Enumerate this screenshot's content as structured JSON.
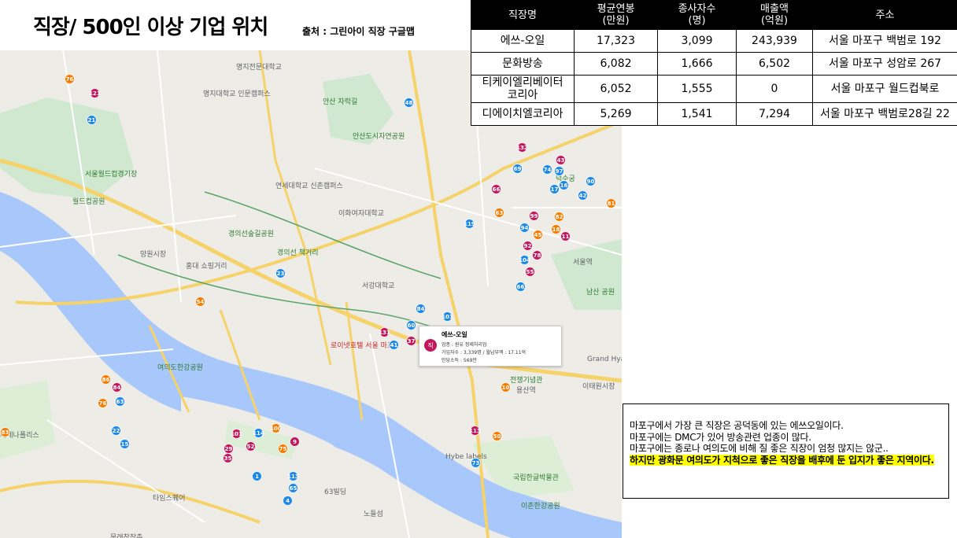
{
  "header": {
    "title": "직장/ 500인 이상 기업 위치",
    "source": "출처 : 그린아이 직장 구글맵"
  },
  "table": {
    "headers": [
      "직장명",
      "평균연봉\n(만원)",
      "종사자수\n(명)",
      "매출액\n(억원)",
      "주소"
    ],
    "rows": [
      {
        "name": "에쓰-오일",
        "salary": "17,323",
        "employees": "3,099",
        "revenue": "243,939",
        "address": "서울 마포구 백범로 192"
      },
      {
        "name": "문화방송",
        "salary": "6,082",
        "employees": "1,666",
        "revenue": "6,502",
        "address": "서울 마포구 성암로 267"
      },
      {
        "name": "티케이엘리베이터\n코리아",
        "salary": "6,052",
        "employees": "1,555",
        "revenue": "0",
        "address": "서울 마포구 월드컵북로"
      },
      {
        "name": "디에이치엘코리아",
        "salary": "5,269",
        "employees": "1,541",
        "revenue": "7,294",
        "address": "서울 마포구 백범로28길 22"
      }
    ]
  },
  "note": {
    "lines": [
      "마포구에서 가장 큰 직장은 공덕동에 있는 에쓰오일이다.",
      "마포구에는 DMC가 있어 방송관련 업종이 많다.",
      "마포구에는 종로나 여의도에 비해 질 좋은 직장이 엄청 많지는 않군..",
      "하지만 광화문 여의도가 지척으로 좋은 직장을 배후에 둔 입지가 좋은 지역이다."
    ]
  },
  "map": {
    "colors": {
      "pink": "#c2185b",
      "blue": "#1e88e5",
      "orange": "#f57c00",
      "river": "#a8c7fa",
      "park": "#c8e6c9"
    },
    "popup": {
      "avatar": "직",
      "name": "에쓰-오일",
      "industry": "업종 : 원유 정제처리업",
      "stats": "가입자수 : 3,339명 / 월납부액 : 17.11억",
      "per_capita": "인당소득 : 569만"
    },
    "labels": [
      "명지전문대학교",
      "명지대학교 인문캠퍼스",
      "안산 자락길",
      "안산도시자연공원",
      "연세대학교 신촌캠퍼스",
      "이화여자대학교",
      "서울월드컵경기장",
      "월드컵공원",
      "경의선숲길공원",
      "망원시장",
      "홍대 쇼핑거리",
      "경의선 책거리",
      "서강대학교",
      "서울역",
      "용산역",
      "여의도한강공원",
      "63빌딩",
      "국립한글박물관",
      "Hybe labels",
      "전쟁기념관",
      "노들섬",
      "이촌한강공원",
      "Grand Hyatt",
      "이태원시장",
      "남산 공원",
      "덕수궁",
      "메세나폴리스",
      "로이넷호텔 서울 마포",
      "타임스퀘어",
      "문래창작촌"
    ],
    "markers": [
      {
        "n": "76",
        "c": "orange"
      },
      {
        "n": "121",
        "c": "pink"
      },
      {
        "n": "21",
        "c": "blue"
      },
      {
        "n": "48",
        "c": "blue"
      },
      {
        "n": "132",
        "c": "pink"
      },
      {
        "n": "43",
        "c": "pink"
      },
      {
        "n": "69",
        "c": "blue"
      },
      {
        "n": "74",
        "c": "blue"
      },
      {
        "n": "97",
        "c": "blue"
      },
      {
        "n": "16",
        "c": "blue"
      },
      {
        "n": "17",
        "c": "blue"
      },
      {
        "n": "90",
        "c": "blue"
      },
      {
        "n": "42",
        "c": "blue"
      },
      {
        "n": "66",
        "c": "pink"
      },
      {
        "n": "81",
        "c": "orange"
      },
      {
        "n": "63",
        "c": "orange"
      },
      {
        "n": "82",
        "c": "orange"
      },
      {
        "n": "99",
        "c": "pink"
      },
      {
        "n": "119",
        "c": "blue"
      },
      {
        "n": "94",
        "c": "blue"
      },
      {
        "n": "45",
        "c": "orange"
      },
      {
        "n": "18",
        "c": "orange"
      },
      {
        "n": "11",
        "c": "pink"
      },
      {
        "n": "92",
        "c": "pink"
      },
      {
        "n": "78",
        "c": "pink"
      },
      {
        "n": "55",
        "c": "pink"
      },
      {
        "n": "104",
        "c": "blue"
      },
      {
        "n": "66",
        "c": "blue"
      },
      {
        "n": "23",
        "c": "blue"
      },
      {
        "n": "54",
        "c": "orange"
      },
      {
        "n": "84",
        "c": "blue"
      },
      {
        "n": "101",
        "c": "blue"
      },
      {
        "n": "131",
        "c": "pink"
      },
      {
        "n": "60",
        "c": "blue"
      },
      {
        "n": "41",
        "c": "blue"
      },
      {
        "n": "37",
        "c": "pink"
      },
      {
        "n": "86",
        "c": "orange"
      },
      {
        "n": "84",
        "c": "pink"
      },
      {
        "n": "76",
        "c": "orange"
      },
      {
        "n": "63",
        "c": "blue"
      },
      {
        "n": "22",
        "c": "blue"
      },
      {
        "n": "15",
        "c": "blue"
      },
      {
        "n": "101",
        "c": "pink"
      },
      {
        "n": "114",
        "c": "blue"
      },
      {
        "n": "100",
        "c": "orange"
      },
      {
        "n": "29",
        "c": "pink"
      },
      {
        "n": "52",
        "c": "pink"
      },
      {
        "n": "35",
        "c": "pink"
      },
      {
        "n": "9",
        "c": "pink"
      },
      {
        "n": "75",
        "c": "orange"
      },
      {
        "n": "1",
        "c": "blue"
      },
      {
        "n": "113",
        "c": "blue"
      },
      {
        "n": "4",
        "c": "blue"
      },
      {
        "n": "10",
        "c": "orange"
      },
      {
        "n": "113",
        "c": "pink"
      },
      {
        "n": "73",
        "c": "blue"
      },
      {
        "n": "83",
        "c": "orange"
      },
      {
        "n": "65",
        "c": "blue"
      },
      {
        "n": "50",
        "c": "orange"
      }
    ]
  }
}
